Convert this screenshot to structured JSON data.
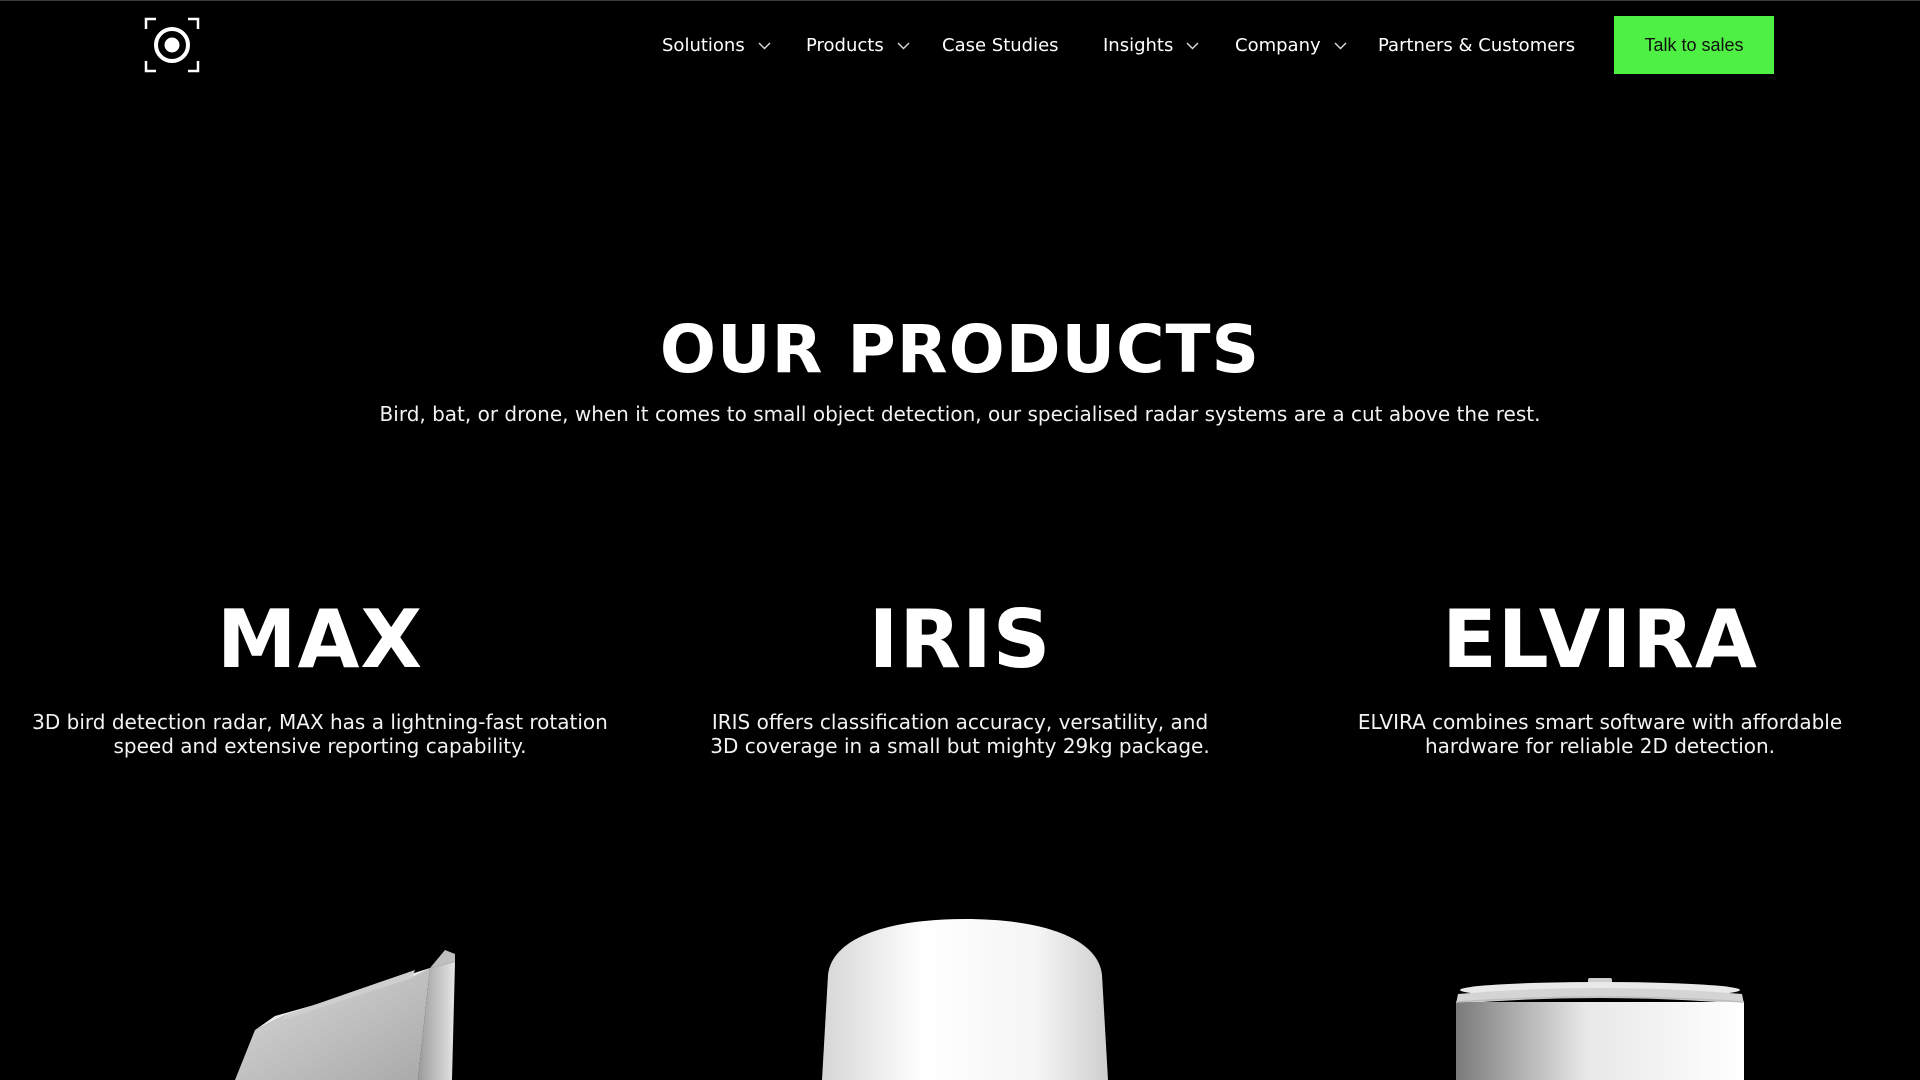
{
  "header": {
    "logo_icon": "radar-target-logo-icon",
    "nav": [
      {
        "label": "Solutions",
        "has_dropdown": true
      },
      {
        "label": "Products",
        "has_dropdown": true
      },
      {
        "label": "Case Studies",
        "has_dropdown": false
      },
      {
        "label": "Insights",
        "has_dropdown": true
      },
      {
        "label": "Company",
        "has_dropdown": true
      },
      {
        "label": "Partners & Customers",
        "has_dropdown": false
      }
    ],
    "cta_label": "Talk to sales"
  },
  "hero": {
    "title": "OUR PRODUCTS",
    "subtitle": "Bird, bat, or drone, when it comes to small object detection, our specialised radar systems are a cut above the rest."
  },
  "products": [
    {
      "name": "MAX",
      "description": "3D bird detection radar, MAX has a lightning-fast rotation speed and extensive reporting capability.",
      "image_icon": "max-radar-panel-image"
    },
    {
      "name": "IRIS",
      "description": "IRIS offers classification accuracy, versatility, and 3D coverage in a small but mighty 29kg package.",
      "image_icon": "iris-radar-dome-image"
    },
    {
      "name": "ELVIRA",
      "description": "ELVIRA combines smart software with affordable hardware for reliable 2D detection.",
      "image_icon": "elvira-radar-cylinder-image"
    }
  ],
  "colors": {
    "background": "#000000",
    "text": "#ffffff",
    "cta_background": "#4ff044",
    "cta_text": "#111111"
  }
}
